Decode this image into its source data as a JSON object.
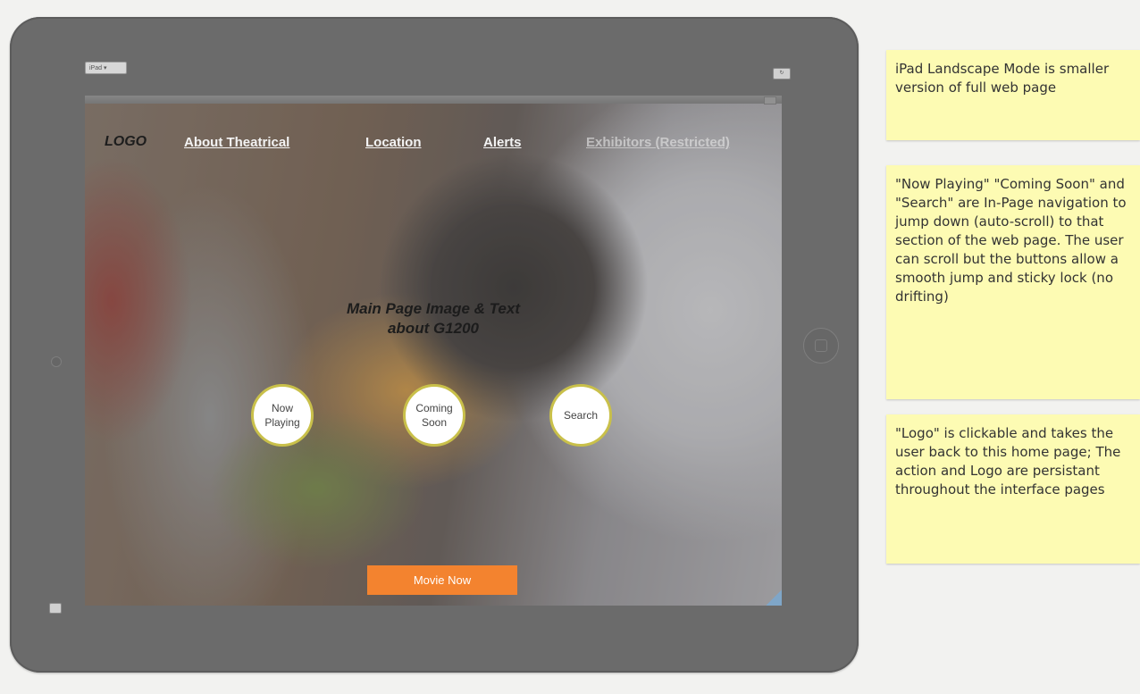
{
  "device": {
    "selector_label": "iPad ▾",
    "rotate_label": "↻"
  },
  "nav": {
    "logo": "LOGO",
    "links": [
      "About Theatrical",
      "Location",
      "Alerts",
      "Exhibitors (Restricted)"
    ]
  },
  "hero": {
    "headline_line1": "Main Page Image & Text",
    "headline_line2": "about G1200"
  },
  "buttons": {
    "now_playing": [
      "Now",
      "Playing"
    ],
    "coming_soon": [
      "Coming",
      "Soon"
    ],
    "search": "Search",
    "cta": "Movie Now"
  },
  "notes": [
    "iPad Landscape Mode is smaller version of full web page",
    "\"Now Playing\" \"Coming Soon\" and \"Search\" are In-Page navigation to jump down (auto-scroll) to that section of the web page. The user can scroll but the buttons allow a smooth jump and sticky lock (no drifting)",
    "\"Logo\" is clickable and takes the user back to this home page; The action and Logo are persistant throughout the interface pages"
  ],
  "colors": {
    "cta": "#f3832f",
    "note_background": "#fdfbb3",
    "circle_border": "#c9c04a"
  }
}
